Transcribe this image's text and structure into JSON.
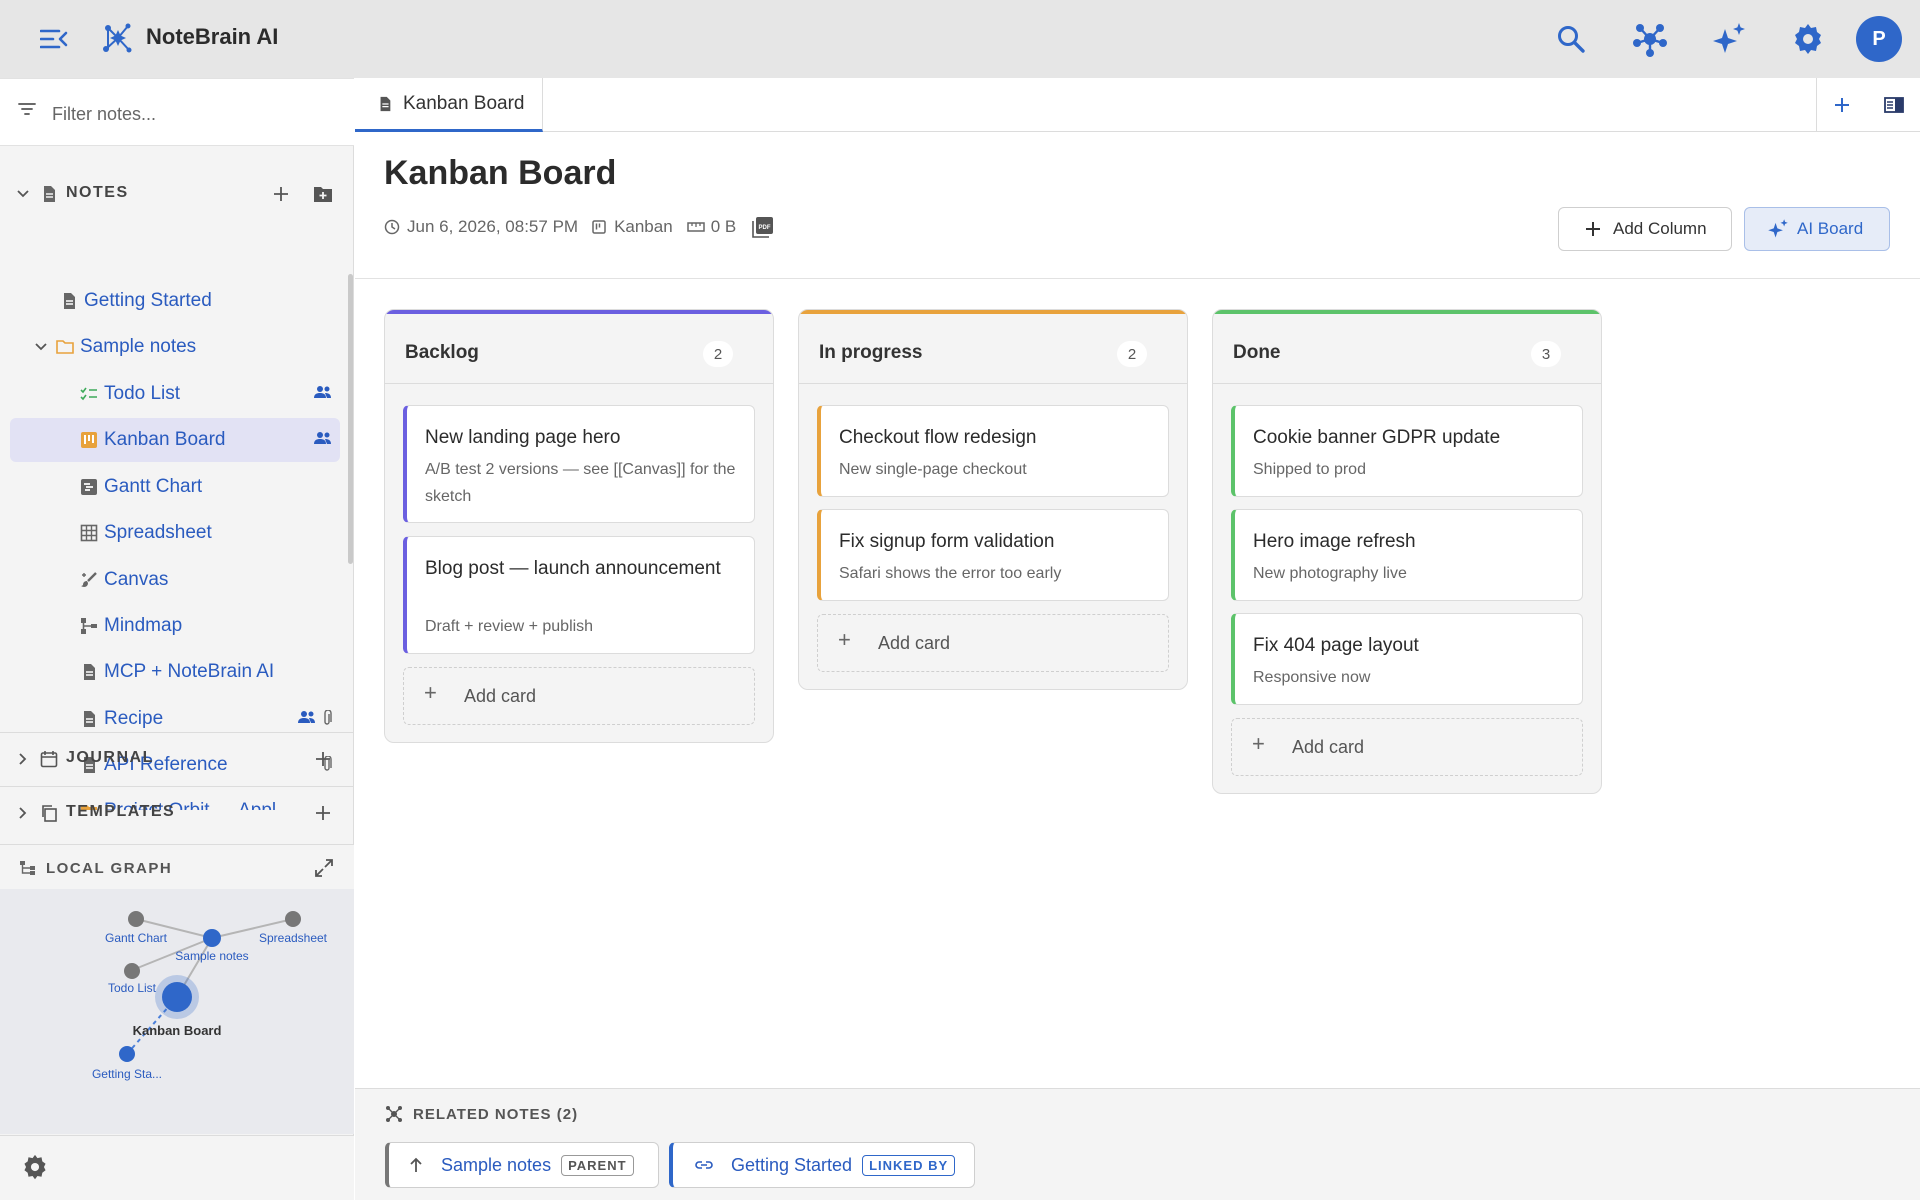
{
  "app": {
    "title": "NoteBrain AI",
    "avatar_initial": "P"
  },
  "sidebar": {
    "filter_placeholder": "Filter notes...",
    "notes_label": "NOTES",
    "journal_label": "JOURNAL",
    "templates_label": "TEMPLATES",
    "local_graph_label": "LOCAL GRAPH",
    "tree": [
      {
        "label": "Getting Started",
        "icon": "document-icon"
      },
      {
        "label": "Sample notes",
        "icon": "folder-icon"
      },
      {
        "label": "Todo List",
        "icon": "checklist-icon"
      },
      {
        "label": "Kanban Board",
        "icon": "kanban-icon"
      },
      {
        "label": "Gantt Chart",
        "icon": "gantt-icon"
      },
      {
        "label": "Spreadsheet",
        "icon": "grid-icon"
      },
      {
        "label": "Canvas",
        "icon": "brush-icon"
      },
      {
        "label": "Mindmap",
        "icon": "mindmap-icon"
      },
      {
        "label": "MCP + NoteBrain AI",
        "icon": "document-icon"
      },
      {
        "label": "Recipe",
        "icon": "document-icon"
      },
      {
        "label": "API Reference",
        "icon": "document-icon"
      },
      {
        "label": "Project Orbit — Appl",
        "icon": "folder-icon"
      }
    ]
  },
  "graph": {
    "nodes": [
      {
        "label": "Gantt Chart"
      },
      {
        "label": "Sample notes"
      },
      {
        "label": "Spreadsheet"
      },
      {
        "label": "Todo List"
      },
      {
        "label": "Kanban Board"
      },
      {
        "label": "Getting Sta..."
      }
    ]
  },
  "tab": {
    "label": "Kanban Board"
  },
  "page": {
    "title": "Kanban Board",
    "date": "Jun 6, 2026, 08:57 PM",
    "type": "Kanban",
    "size": "0 B",
    "add_column": "Add Column",
    "ai_board": "AI Board"
  },
  "board": {
    "add_card_label": "Add card",
    "columns": [
      {
        "title": "Backlog",
        "count": "2",
        "color": "#6b5fe0",
        "cards": [
          {
            "title": "New landing page hero",
            "desc": "A/B test 2 versions — see [[Canvas]] for the sketch"
          },
          {
            "title": "Blog post — launch announcement",
            "desc": "Draft + review + publish"
          }
        ]
      },
      {
        "title": "In progress",
        "count": "2",
        "color": "#e8a23c",
        "cards": [
          {
            "title": "Checkout flow redesign",
            "desc": "New single-page checkout"
          },
          {
            "title": "Fix signup form validation",
            "desc": "Safari shows the error too early"
          }
        ]
      },
      {
        "title": "Done",
        "count": "3",
        "color": "#5cc36a",
        "cards": [
          {
            "title": "Cookie banner GDPR update",
            "desc": "Shipped to prod"
          },
          {
            "title": "Hero image refresh",
            "desc": "New photography live"
          },
          {
            "title": "Fix 404 page layout",
            "desc": "Responsive now"
          }
        ]
      }
    ]
  },
  "related": {
    "heading": "RELATED NOTES (2)",
    "items": [
      {
        "label": "Sample notes",
        "badge": "PARENT"
      },
      {
        "label": "Getting Started",
        "badge": "LINKED BY"
      }
    ]
  },
  "colors": {
    "accent": "#2f67c9",
    "link": "#2a5bbf"
  }
}
